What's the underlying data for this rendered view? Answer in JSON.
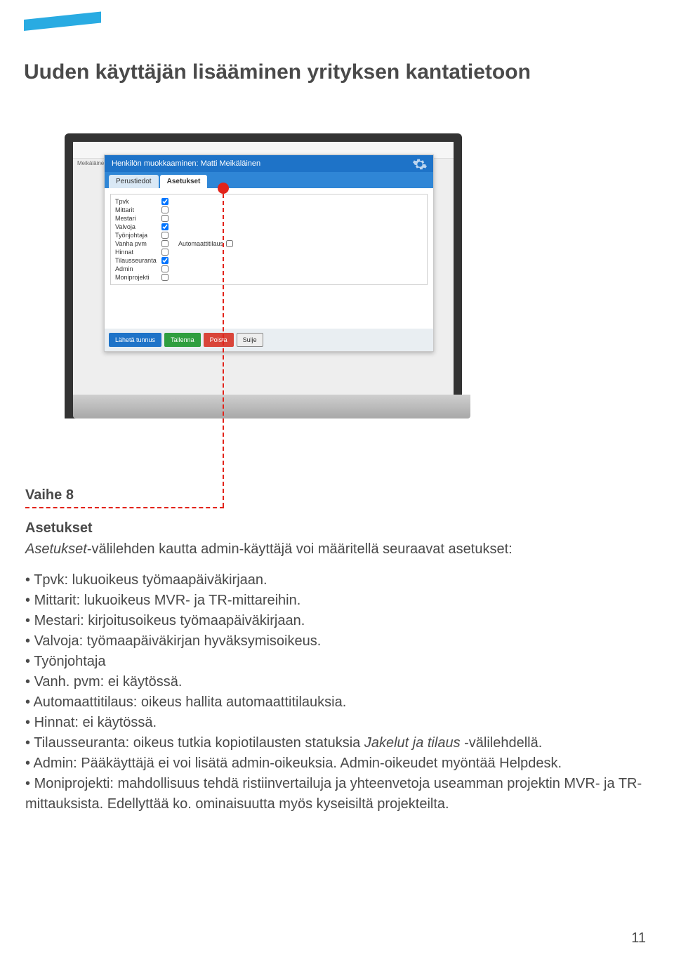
{
  "page": {
    "title": "Uuden käyttäjän lisääminen yrityksen kantatietoon",
    "number": "11"
  },
  "step": {
    "name": "Vaihe 8",
    "heading": "Asetukset",
    "intro_prefix_italic": "Asetukset",
    "intro_rest": "-välilehden kautta admin-käyttäjä voi määritellä seuraavat asetukset:"
  },
  "bullets": [
    "Tpvk: lukuoikeus työmaapäiväkirjaan.",
    "Mittarit: lukuoikeus MVR- ja TR-mittareihin.",
    "Mestari: kirjoitusoikeus työmaapäiväkirjaan.",
    "Valvoja: työmaapäiväkirjan hyväksymisoikeus.",
    "Työnjohtaja",
    "Vanh. pvm: ei käytössä.",
    "Automaattitilaus: oikeus hallita automaattitilauksia.",
    "Hinnat: ei käytössä.",
    "Tilausseuranta: oikeus tutkia kopiotilausten statuksia <i>Jakelut ja tilaus</i> -välilehdellä.",
    "Admin: Pääkäyttäjä ei voi lisätä admin-oikeuksia. Admin-oikeudet myöntää Helpdesk.",
    "Moniprojekti: mahdollisuus tehdä ristiinvertailuja ja yhteenvetoja useamman projektin MVR- ja TR-mittauksista. Edellyttää ko. ominaisuutta myös kyseisiltä projekteilta."
  ],
  "modal": {
    "title": "Henkilön muokkaaminen: Matti Meikäläinen",
    "bg_name": "Meikäläinen, Matti",
    "tabs": {
      "perustiedot": "Perustiedot",
      "asetukset": "Asetukset"
    },
    "settings": [
      {
        "label": "Tpvk",
        "checked": true
      },
      {
        "label": "Mittarit",
        "checked": false
      },
      {
        "label": "Mestari",
        "checked": false
      },
      {
        "label": "Valvoja",
        "checked": true
      },
      {
        "label": "Työnjohtaja",
        "checked": false
      },
      {
        "label": "Vanha pvm",
        "checked": false,
        "extra_label": "Automaattitilaus",
        "extra_checked": false
      },
      {
        "label": "Hinnat",
        "checked": false
      },
      {
        "label": "Tilausseuranta",
        "checked": true
      },
      {
        "label": "Admin",
        "checked": false
      },
      {
        "label": "Moniprojekti",
        "checked": false
      }
    ],
    "buttons": {
      "send": "Lähetä tunnus",
      "save": "Tallenna",
      "delete": "Poista",
      "close": "Sulje"
    }
  }
}
